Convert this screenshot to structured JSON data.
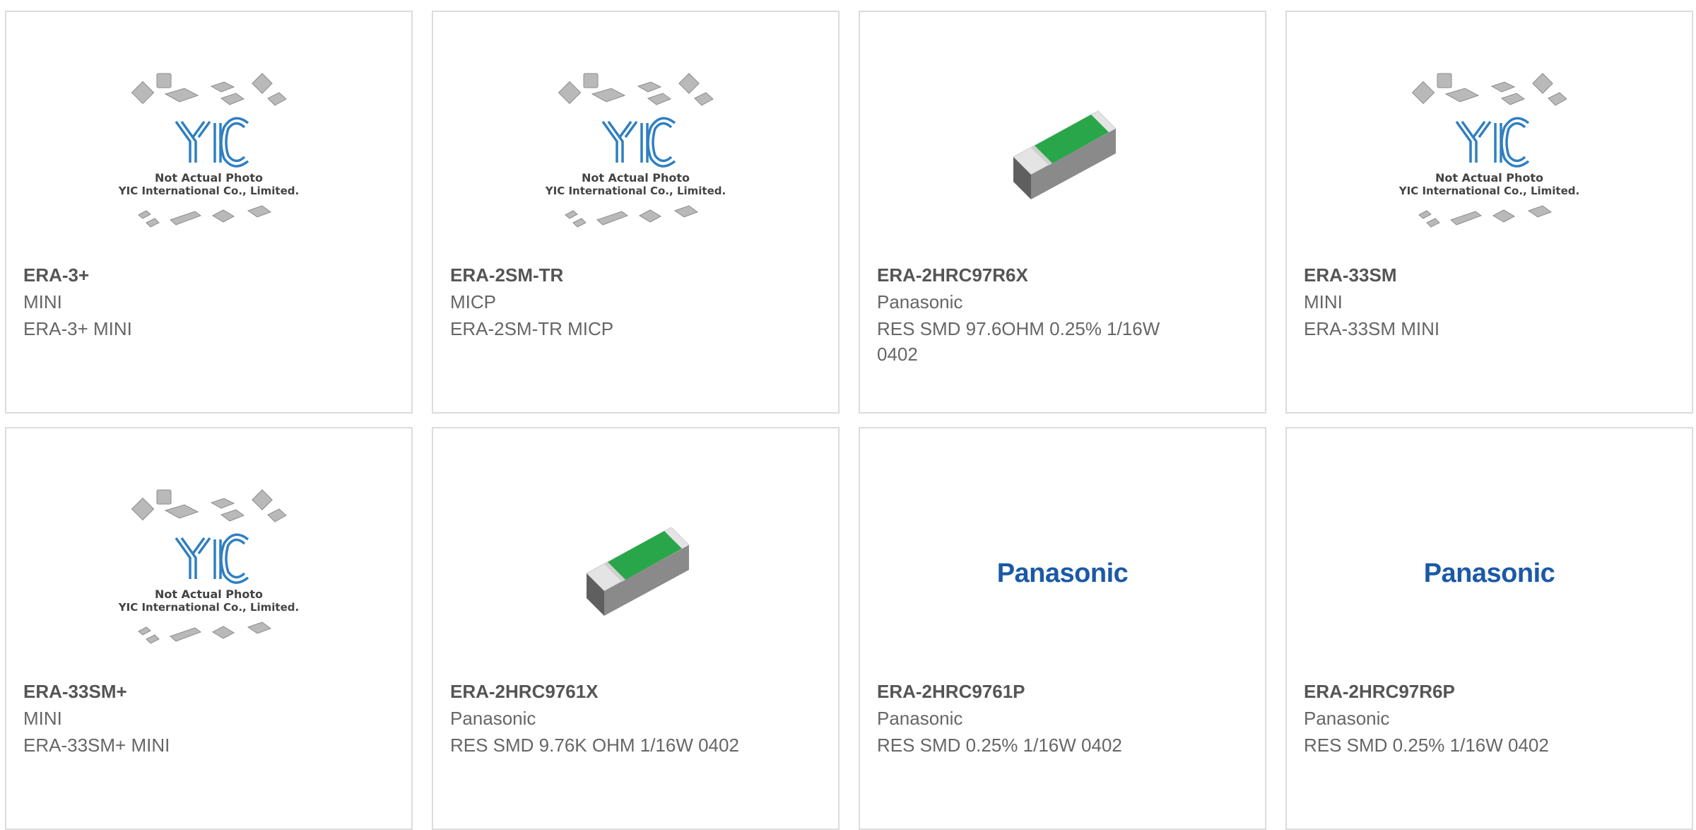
{
  "products": [
    {
      "part": "ERA-3+",
      "manufacturer": "MINI",
      "description": "ERA-3+ MINI",
      "image": "yic-placeholder"
    },
    {
      "part": "ERA-2SM-TR",
      "manufacturer": "MICP",
      "description": "ERA-2SM-TR MICP",
      "image": "yic-placeholder"
    },
    {
      "part": "ERA-2HRC97R6X",
      "manufacturer": "Panasonic",
      "description": "RES SMD 97.6OHM 0.25% 1/16W 0402",
      "image": "smd-resistor"
    },
    {
      "part": "ERA-33SM",
      "manufacturer": "MINI",
      "description": "ERA-33SM MINI",
      "image": "yic-placeholder"
    },
    {
      "part": "ERA-33SM+",
      "manufacturer": "MINI",
      "description": "ERA-33SM+ MINI",
      "image": "yic-placeholder"
    },
    {
      "part": "ERA-2HRC9761X",
      "manufacturer": "Panasonic",
      "description": "RES SMD 9.76K OHM 1/16W 0402",
      "image": "smd-resistor"
    },
    {
      "part": "ERA-2HRC9761P",
      "manufacturer": "Panasonic",
      "description": "RES SMD 0.25% 1/16W 0402",
      "image": "panasonic-logo"
    },
    {
      "part": "ERA-2HRC97R6P",
      "manufacturer": "Panasonic",
      "description": "RES SMD 0.25% 1/16W 0402",
      "image": "panasonic-logo"
    }
  ],
  "placeholder": {
    "line1": "Not Actual Photo",
    "line2": "YIC International Co., Limited."
  },
  "panasonic_logo_text": "Panasonic",
  "colors": {
    "accent": "#e63e12",
    "bar": "#444444",
    "border": "#dcdcdc",
    "text": "#555555",
    "yic_blue": "#2f7fc1",
    "panasonic_blue": "#1b59a6"
  }
}
